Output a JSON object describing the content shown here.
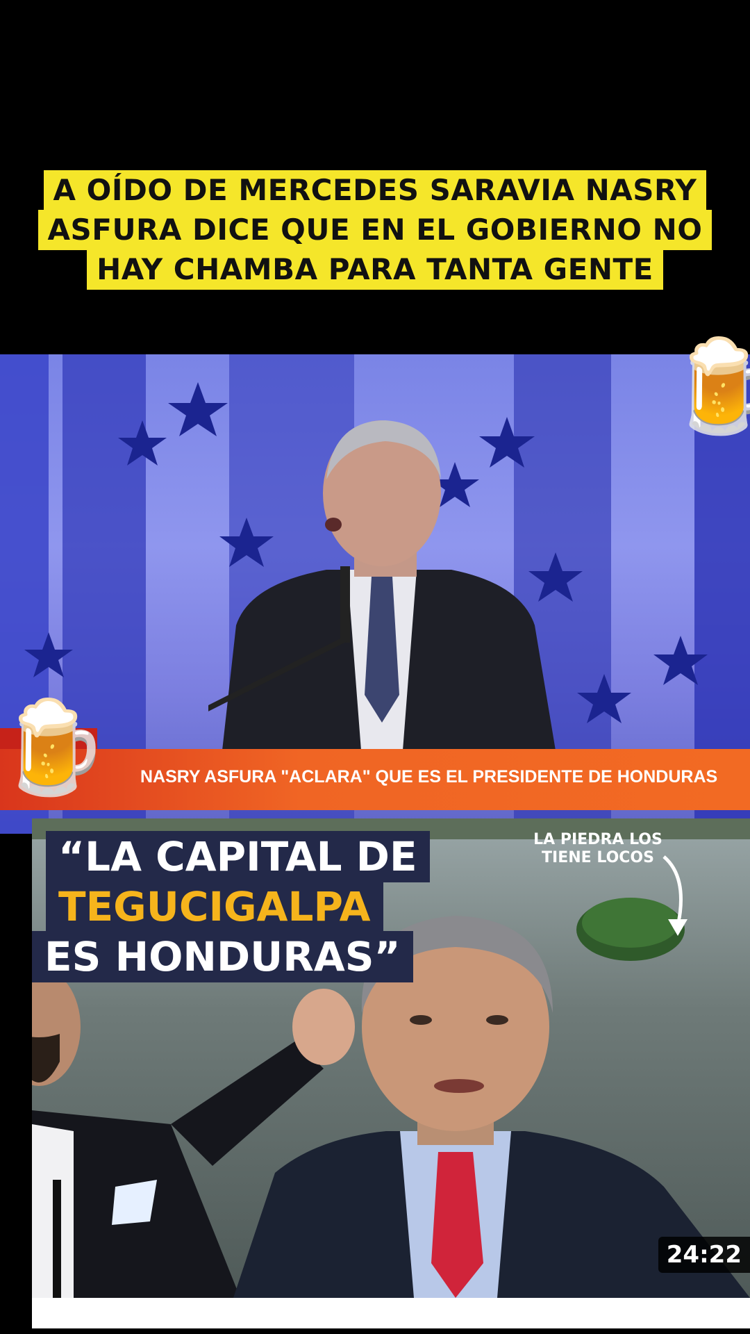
{
  "caption": {
    "lines": [
      "A OÍDO DE MERCEDES SARAVIA NASRY",
      "ASFURA DICE QUE EN EL GOBIERNO NO",
      "HAY CHAMBA PARA TANTA GENTE"
    ]
  },
  "top_clip": {
    "ticker_text": "NASRY ASFURA \"ACLARA\" QUE ES EL PRESIDENTE DE HONDURAS",
    "overlay_emoji": "🍺"
  },
  "bottom_thumbnail": {
    "title_line1": "“LA CAPITAL DE",
    "title_line2": "TEGUCIGALPA",
    "title_line3": "ES HONDURAS”",
    "annotation": "LA PIEDRA LOS\nTIENE LOCOS",
    "duration": "24:22"
  },
  "colors": {
    "caption_bg": "#f5e62a",
    "ticker_bg": "#f06524",
    "title_bg": "#232949",
    "title_highlight": "#f6b41c"
  }
}
